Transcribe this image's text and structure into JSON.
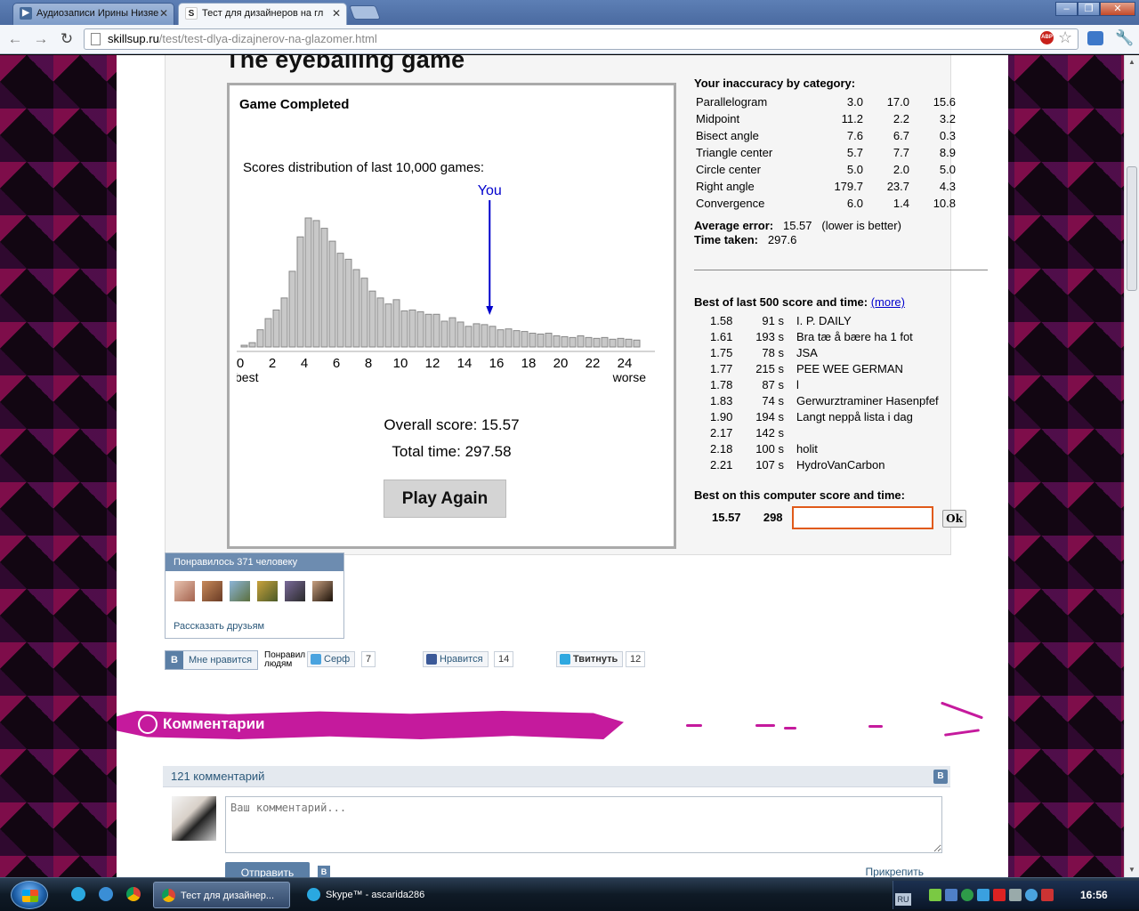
{
  "browser": {
    "tabs": [
      {
        "label": "Аудиозаписи Ирины Низяе",
        "active": false
      },
      {
        "label": "Тест для дизайнеров на гл",
        "active": true
      }
    ],
    "url_host": "skillsup.ru",
    "url_path": "/test/test-dlya-dizajnerov-na-glazomer.html",
    "abp_label": "ABP"
  },
  "game": {
    "title": "The eyeballing game",
    "status": "Game Completed",
    "distribution_label": "Scores distribution of last 10,000 games:",
    "you_label": "You",
    "axis_best": "best",
    "axis_worse": "worse",
    "overall_score": "Overall score: 15.57",
    "total_time": "Total time: 297.58",
    "play_again": "Play Again"
  },
  "chart_data": {
    "type": "bar",
    "title": "Scores distribution of last 10,000 games:",
    "xlabel": "",
    "ylabel": "",
    "x_tick_labels": [
      "0",
      "2",
      "4",
      "6",
      "8",
      "10",
      "12",
      "14",
      "16",
      "18",
      "20",
      "22",
      "24"
    ],
    "xlim": [
      0,
      25
    ],
    "bin_width": 0.5,
    "x_start": 0.25,
    "values": [
      2,
      5,
      20,
      33,
      43,
      57,
      88,
      128,
      150,
      147,
      138,
      123,
      109,
      102,
      90,
      80,
      65,
      57,
      50,
      55,
      42,
      43,
      41,
      38,
      38,
      30,
      34,
      29,
      24,
      27,
      26,
      24,
      20,
      21,
      19,
      18,
      16,
      15,
      16,
      13,
      12,
      11,
      13,
      11,
      10,
      11,
      9,
      10,
      9,
      8
    ],
    "marker": {
      "label": "You",
      "x": 15.57
    }
  },
  "stats": {
    "category_title": "Your inaccuracy by category:",
    "categories": [
      {
        "name": "Parallelogram",
        "v1": "3.0",
        "v2": "17.0",
        "v3": "15.6"
      },
      {
        "name": "Midpoint",
        "v1": "11.2",
        "v2": "2.2",
        "v3": "3.2"
      },
      {
        "name": "Bisect angle",
        "v1": "7.6",
        "v2": "6.7",
        "v3": "0.3"
      },
      {
        "name": "Triangle center",
        "v1": "5.7",
        "v2": "7.7",
        "v3": "8.9"
      },
      {
        "name": "Circle center",
        "v1": "5.0",
        "v2": "2.0",
        "v3": "5.0"
      },
      {
        "name": "Right angle",
        "v1": "179.7",
        "v2": "23.7",
        "v3": "4.3"
      },
      {
        "name": "Convergence",
        "v1": "6.0",
        "v2": "1.4",
        "v3": "10.8"
      }
    ],
    "avg_label": "Average error:",
    "avg_value": "15.57",
    "avg_note": "(lower is better)",
    "time_label": "Time taken:",
    "time_value": "297.6",
    "best500_title": "Best of last 500 score and time:",
    "best500_more": "(more)",
    "best500": [
      {
        "score": "1.58",
        "time": "91 s",
        "name": "I. P. DAILY"
      },
      {
        "score": "1.61",
        "time": "193 s",
        "name": "Bra tæ å bære ha 1 fot"
      },
      {
        "score": "1.75",
        "time": "78 s",
        "name": "JSA"
      },
      {
        "score": "1.77",
        "time": "215 s",
        "name": "PEE WEE GERMAN"
      },
      {
        "score": "1.78",
        "time": "87 s",
        "name": "l"
      },
      {
        "score": "1.83",
        "time": "74 s",
        "name": "Gerwurztraminer Hasenpfef"
      },
      {
        "score": "1.90",
        "time": "194 s",
        "name": "Langt neppå lista i dag"
      },
      {
        "score": "2.17",
        "time": "142 s",
        "name": ""
      },
      {
        "score": "2.18",
        "time": "100 s",
        "name": "holit"
      },
      {
        "score": "2.21",
        "time": "107 s",
        "name": "HydroVanCarbon"
      }
    ],
    "best_computer_title": "Best on this computer score and time:",
    "best_computer_score": "15.57",
    "best_computer_time": "298",
    "name_input_value": "",
    "ok_label": "Ok"
  },
  "social": {
    "vk_popup_header": "Понравилось 371 человеку",
    "vk_tell_friends": "Рассказать друзьям",
    "vk_like_label": "Мне нравится",
    "vk_b": "B",
    "liked_line1": "Понравил",
    "liked_line2": "людям",
    "surf_label": "Серф",
    "surf_count": "7",
    "fb_label": "Нравится",
    "fb_count": "14",
    "tw_label": "Твитнуть",
    "tw_count": "12"
  },
  "comments": {
    "banner_title": "Комментарии",
    "count_label": "121 комментарий",
    "input_placeholder": "Ваш комментарий...",
    "send_label": "Отправить",
    "attach_label": "Прикрепить"
  },
  "taskbar": {
    "tasks": [
      {
        "label": "Тест для дизайнер...",
        "active": true
      },
      {
        "label": "Skype™ - ascarida286",
        "active": false
      }
    ],
    "lang": "RU",
    "clock": "16:56"
  }
}
